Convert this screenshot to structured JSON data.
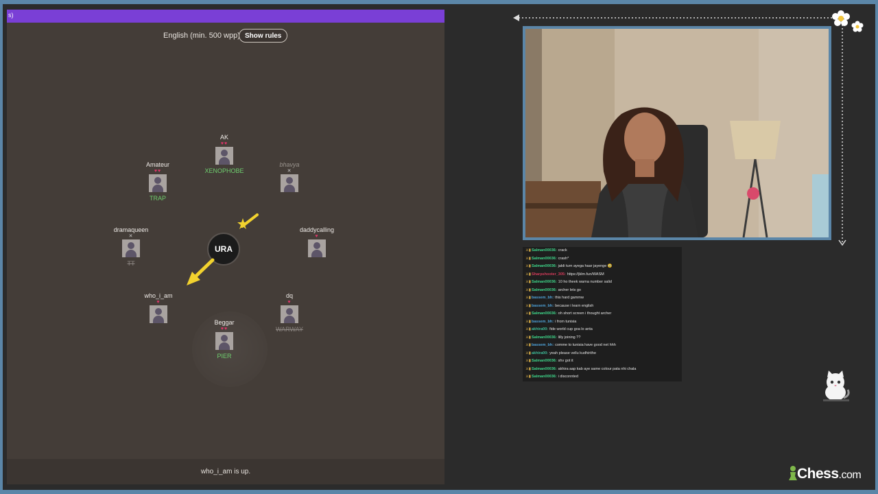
{
  "game": {
    "topbar_text": "s)",
    "language_label": "English (min. 500 wpp)",
    "show_rules_label": "Show rules",
    "bomb_syllable": "URA",
    "status_text": "who_i_am is up.",
    "players": [
      {
        "name": "AK",
        "lives": "♥♥",
        "word": "XENOPHOBE",
        "alive": true
      },
      {
        "name": "Amateur",
        "lives": "♥♥",
        "word": "TRAP",
        "alive": true
      },
      {
        "name": "bhavya",
        "lives": "",
        "word": "",
        "alive": false
      },
      {
        "name": "dramaqueen",
        "lives": "",
        "word": "TT",
        "alive": false
      },
      {
        "name": "daddycalling",
        "lives": "♥",
        "word": "",
        "alive": true
      },
      {
        "name": "who_i_am",
        "lives": "♥",
        "word": "",
        "alive": true
      },
      {
        "name": "dq",
        "lives": "♥",
        "word": "WARWAY",
        "alive": true
      },
      {
        "name": "Beggar",
        "lives": "♥♥",
        "word": "PIER",
        "alive": true
      }
    ]
  },
  "chat": {
    "messages": [
      {
        "user": "Salman00036:",
        "text": "crack",
        "color": "#3fd68a"
      },
      {
        "user": "Salman00036:",
        "text": "crash*",
        "color": "#3fd68a"
      },
      {
        "user": "Salman00036:",
        "text": "jaldi turn ayega haar jayenge 🥹",
        "color": "#3fd68a"
      },
      {
        "user": "Sharpshooter_305:",
        "text": "https://jklm.fun/WASM",
        "color": "#d43b5a"
      },
      {
        "user": "Salman00036:",
        "text": "10 ho theek warna number salid",
        "color": "#3fd68a"
      },
      {
        "user": "Salman00036:",
        "text": "archer lets go",
        "color": "#3fd68a"
      },
      {
        "user": "bassem_bh:",
        "text": "this hard gammw",
        "color": "#4fa3d9"
      },
      {
        "user": "bassem_bh:",
        "text": "because i learn english",
        "color": "#4fa3d9"
      },
      {
        "user": "Salman00036:",
        "text": "oh short screen i thought archer",
        "color": "#3fd68a"
      },
      {
        "user": "bassem_bh:",
        "text": "i from tunisia",
        "color": "#4fa3d9"
      },
      {
        "user": "akhira00:",
        "text": "fide world cup goa lo anta",
        "color": "#3fbf9b"
      },
      {
        "user": "Salman00036:",
        "text": "lilly joining ??",
        "color": "#3fd68a"
      },
      {
        "user": "bassem_bh:",
        "text": "comme to tunisia have good net hhh",
        "color": "#4fa3d9"
      },
      {
        "user": "akhira00:",
        "text": "yeah please vellu kudhirithe",
        "color": "#3fbf9b"
      },
      {
        "user": "Salman00036:",
        "text": "shv got it",
        "color": "#3fd68a"
      },
      {
        "user": "Salman00036:",
        "text": "akhira aap kab aye same colour pata nhi chala",
        "color": "#3fd68a"
      },
      {
        "user": "Salman00036:",
        "text": "i disconnted",
        "color": "#3fd68a"
      }
    ]
  },
  "brand": {
    "name": "Chess",
    "suffix": ".com"
  },
  "colors": {
    "frame": "#5b86a8",
    "topbar": "#7a3fd6",
    "heart": "#e0356a",
    "word_green": "#6fcf6f",
    "bomb_arrow": "#f2d22e"
  }
}
